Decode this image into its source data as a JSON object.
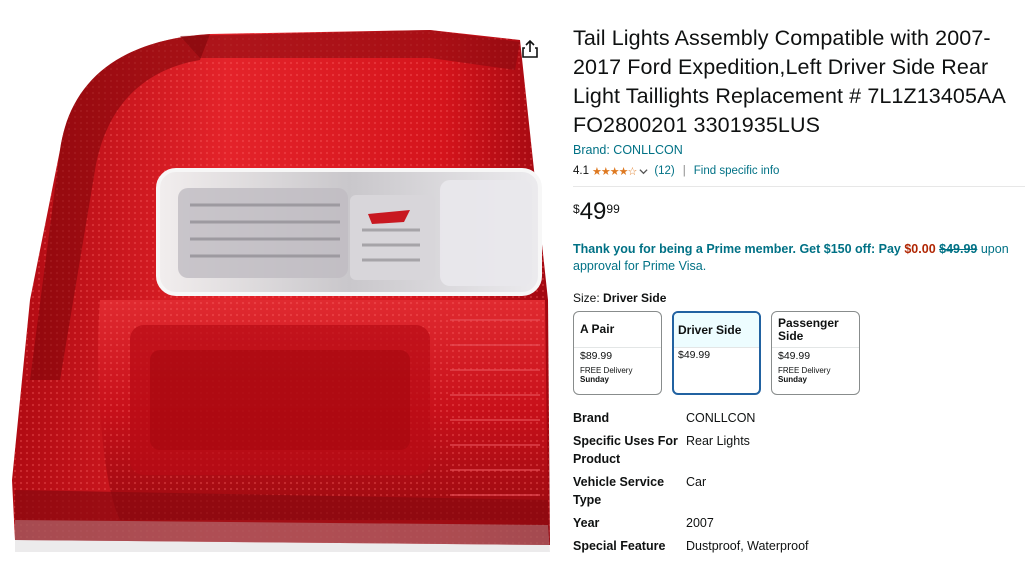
{
  "product": {
    "title": "Tail Lights Assembly Compatible with 2007-2017 Ford Expedition,Left Driver Side Rear Light Taillights Replacement # 7L1Z13405AA FO2800201 3301935LUS",
    "brand_link": "Brand: CONLLCON",
    "rating_value": "4.1",
    "stars": "★★★★☆",
    "rating_count": "(12)",
    "separator": "|",
    "find_info": "Find specific info"
  },
  "price": {
    "symbol": "$",
    "whole": "49",
    "fraction": "99"
  },
  "prime_offer": {
    "lead": "Thank you for being a Prime member. Get $150 off: Pay",
    "pay_amount": "$0.00",
    "original": "$49.99",
    "tail": "upon approval for Prime Visa."
  },
  "size": {
    "label": "Size:",
    "selected": "Driver Side",
    "options": [
      {
        "name": "A Pair",
        "price": "$89.99",
        "delivery": "FREE Delivery",
        "day": "Sunday"
      },
      {
        "name": "Driver Side",
        "price": "$49.99",
        "delivery": "",
        "day": ""
      },
      {
        "name": "Passenger Side",
        "price": "$49.99",
        "delivery": "FREE Delivery",
        "day": "Sunday"
      }
    ]
  },
  "specs": [
    {
      "key": "Brand",
      "value": "CONLLCON"
    },
    {
      "key": "Specific Uses For Product",
      "value": "Rear Lights"
    },
    {
      "key": "Vehicle Service Type",
      "value": "Car"
    },
    {
      "key": "Year",
      "value": "2007"
    },
    {
      "key": "Special Feature",
      "value": "Dustproof, Waterproof"
    }
  ],
  "icons": {
    "share": "share-icon",
    "chevron": "chevron-down-icon"
  },
  "colors": {
    "link": "#007185",
    "star": "#de7921",
    "price_red": "#b12704",
    "selected_border": "#2162a1",
    "lamp_red": "#d4141c"
  }
}
